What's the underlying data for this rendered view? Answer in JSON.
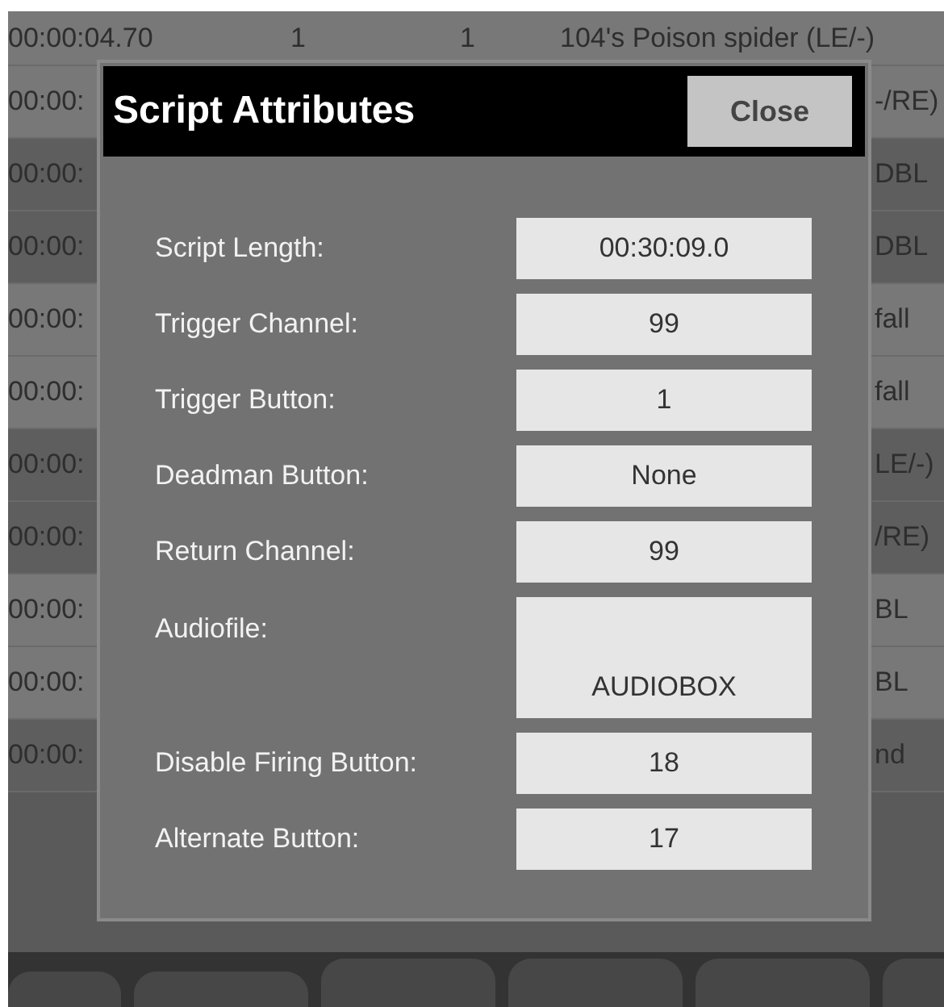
{
  "list_rows": [
    {
      "cells": [
        "00:00:04.70",
        "1",
        "1",
        "104's Poison spider (LE/-)"
      ],
      "shaded": false
    },
    {
      "cells": [
        "00:00:",
        "-/RE)"
      ],
      "shaded": false
    },
    {
      "cells": [
        "00:00:",
        "DBL"
      ],
      "shaded": true
    },
    {
      "cells": [
        "00:00:",
        "DBL"
      ],
      "shaded": true
    },
    {
      "cells": [
        "00:00:",
        "fall"
      ],
      "shaded": false
    },
    {
      "cells": [
        "00:00:",
        "fall"
      ],
      "shaded": false
    },
    {
      "cells": [
        "00:00:",
        "LE/-)"
      ],
      "shaded": true
    },
    {
      "cells": [
        "00:00:",
        "/RE)"
      ],
      "shaded": true
    },
    {
      "cells": [
        "00:00:",
        "BL"
      ],
      "shaded": false
    },
    {
      "cells": [
        "00:00:",
        "BL"
      ],
      "shaded": false
    },
    {
      "cells": [
        "00:00:",
        "nd"
      ],
      "shaded": true
    }
  ],
  "dialog": {
    "title": "Script Attributes",
    "close_button": "Close",
    "attributes": [
      {
        "label": "Script Length:",
        "value": "00:30:09.0",
        "kind": "single"
      },
      {
        "label": "Trigger Channel:",
        "value": "99",
        "kind": "single"
      },
      {
        "label": "Trigger Button:",
        "value": "1",
        "kind": "single"
      },
      {
        "label": "Deadman Button:",
        "value": "None",
        "kind": "single"
      },
      {
        "label": "Return Channel:",
        "value": "99",
        "kind": "single"
      },
      {
        "label": "Audiofile:",
        "value": "AUDIOBOX",
        "kind": "tall"
      },
      {
        "label": "Disable Firing Button:",
        "value": "18",
        "kind": "single"
      },
      {
        "label": "Alternate Button:",
        "value": "17",
        "kind": "single"
      }
    ]
  }
}
